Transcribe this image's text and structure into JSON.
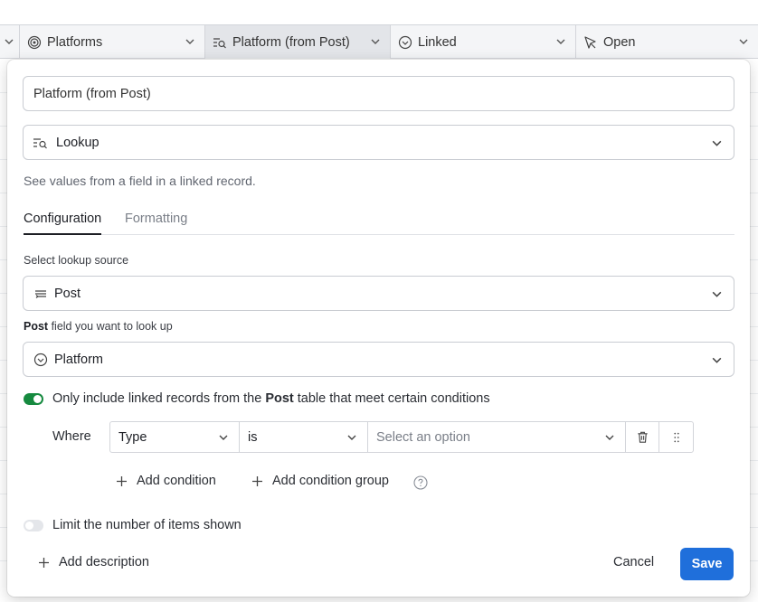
{
  "grid": {
    "columns": [
      {
        "label": "Platforms",
        "icon": "radar-icon"
      },
      {
        "label": "Platform (from Post)",
        "icon": "lookup-icon"
      },
      {
        "label": "Linked",
        "icon": "circle-check-icon"
      },
      {
        "label": "Open",
        "icon": "cursor-icon"
      }
    ]
  },
  "dialog": {
    "field_name": "Platform (from Post)",
    "field_type": "Lookup",
    "field_type_description": "See values from a field in a linked record.",
    "tabs": [
      {
        "label": "Configuration",
        "active": true
      },
      {
        "label": "Formatting",
        "active": false
      }
    ],
    "lookup_source_label": "Select lookup source",
    "lookup_source_value": "Post",
    "lookup_field_label_bold": "Post",
    "lookup_field_label_rest": " field you want to look up",
    "lookup_field_value": "Platform",
    "conditions_toggle": {
      "on": true,
      "text_before": "Only include linked records from the ",
      "text_bold": "Post",
      "text_after": " table that meet certain conditions"
    },
    "condition": {
      "where_label": "Where",
      "field": "Type",
      "operator": "is",
      "value_placeholder": "Select an option"
    },
    "add_condition_label": "Add condition",
    "add_condition_group_label": "Add condition group",
    "limit_toggle": {
      "on": false,
      "text": "Limit the number of items shown"
    },
    "add_description_label": "Add description",
    "cancel_label": "Cancel",
    "save_label": "Save"
  },
  "colors": {
    "accent": "#1f6fdb",
    "toggle_on": "#168a3f",
    "text": "#1d1f25",
    "muted": "#616670"
  }
}
